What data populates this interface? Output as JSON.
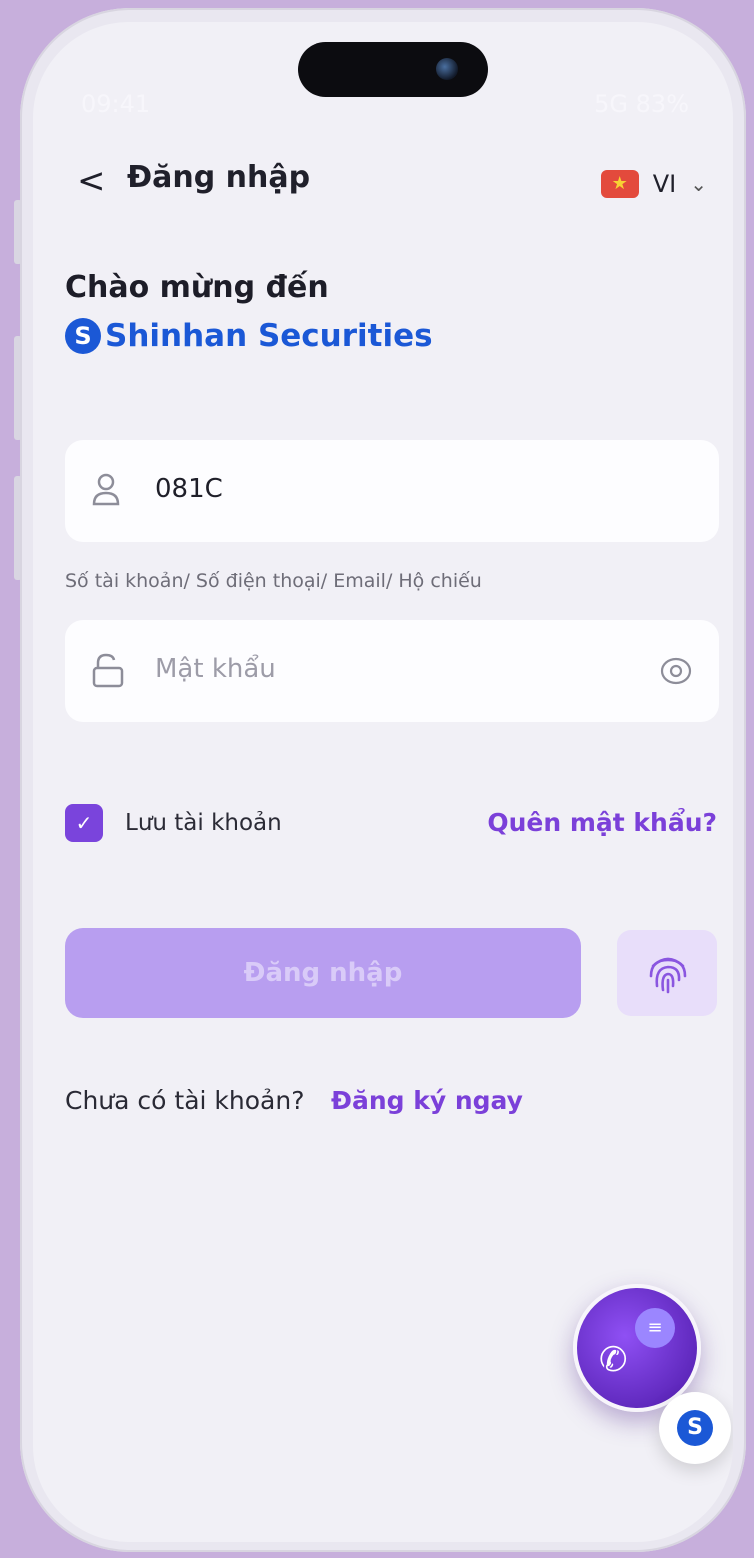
{
  "status_bar": {
    "time": "09:41",
    "right": "5G 83%"
  },
  "header": {
    "back_icon": "<",
    "title": "Đăng nhập",
    "language_code": "VI",
    "language_flag_icon": "vietnam-flag-icon",
    "language_chevron": "⌄"
  },
  "welcome": {
    "line1": "Chào mừng đến",
    "brand_logo": "S",
    "brand_name": "Shinhan Securities"
  },
  "username_field": {
    "icon": "user-icon",
    "value": "081C",
    "hint": "Số tài khoản/ Số điện thoại/ Email/ Hộ chiếu"
  },
  "password_field": {
    "icon": "lock-icon",
    "placeholder": "Mật khẩu",
    "toggle_icon": "eye-icon"
  },
  "remember": {
    "checked": true,
    "label": "Lưu tài khoản"
  },
  "forgot_password": "Quên mật khẩu?",
  "login_button": "Đăng nhập",
  "biometric_icon": "fingerprint-icon",
  "signup": {
    "prompt": "Chưa có tài khoản?",
    "link": "Đăng ký ngay"
  },
  "support": {
    "icon": "phone-chat-icon",
    "badge_logo": "S"
  },
  "colors": {
    "accent": "#7b40d9",
    "brand_blue": "#1b58d6",
    "button_disabled": "#b89ef0",
    "background": "#f1f0f6"
  }
}
